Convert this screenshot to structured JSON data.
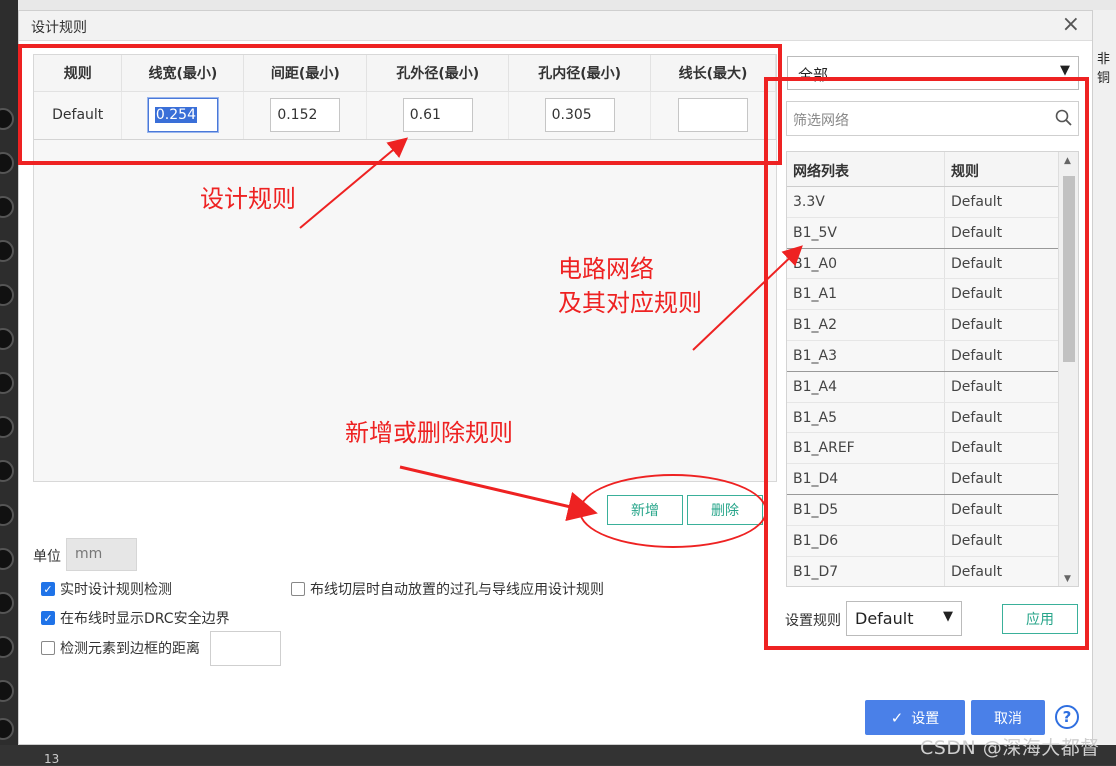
{
  "dialog": {
    "title": "设计规则",
    "close_icon": "×"
  },
  "rules_table": {
    "headers": [
      "规则",
      "线宽(最小)",
      "间距(最小)",
      "孔外径(最小)",
      "孔内径(最小)",
      "线长(最大)"
    ],
    "rows": [
      {
        "name": "Default",
        "line_width": "0.254",
        "spacing": "0.152",
        "hole_outer": "0.61",
        "hole_inner": "0.305",
        "line_length": ""
      }
    ]
  },
  "rule_buttons": {
    "add": "新增",
    "delete": "删除"
  },
  "options": {
    "unit_label": "单位",
    "unit_value": "mm",
    "realtime_drc": {
      "label": "实时设计规则检测",
      "checked": true
    },
    "show_drc_boundary": {
      "label": "在布线时显示DRC安全边界",
      "checked": true
    },
    "check_border_distance": {
      "label": "检测元素到边框的距离",
      "checked": false
    },
    "auto_via_rule": {
      "label": "布线切层时自动放置的过孔与导线应用设计规则",
      "checked": false
    }
  },
  "right_panel": {
    "filter_select": "全部",
    "filter_placeholder": "筛选网络",
    "net_headers": [
      "网络列表",
      "规则"
    ],
    "nets": [
      {
        "net": "3.3V",
        "rule": "Default"
      },
      {
        "net": "B1_5V",
        "rule": "Default"
      },
      {
        "net": "B1_A0",
        "rule": "Default"
      },
      {
        "net": "B1_A1",
        "rule": "Default"
      },
      {
        "net": "B1_A2",
        "rule": "Default"
      },
      {
        "net": "B1_A3",
        "rule": "Default"
      },
      {
        "net": "B1_A4",
        "rule": "Default"
      },
      {
        "net": "B1_A5",
        "rule": "Default"
      },
      {
        "net": "B1_AREF",
        "rule": "Default"
      },
      {
        "net": "B1_D4",
        "rule": "Default"
      },
      {
        "net": "B1_D5",
        "rule": "Default"
      },
      {
        "net": "B1_D6",
        "rule": "Default"
      },
      {
        "net": "B1_D7",
        "rule": "Default"
      }
    ],
    "set_rule_label": "设置规则",
    "set_rule_value": "Default",
    "apply_button": "应用"
  },
  "footer": {
    "ok_button": "设置",
    "cancel_button": "取消",
    "help_icon": "?"
  },
  "annotations": {
    "design_rules": "设计规则",
    "net_rules_line1": "电路网络",
    "net_rules_line2": "及其对应规则",
    "add_delete": "新增或删除规则"
  },
  "background": {
    "right_edge_text": "非铜",
    "bottom_number": "13",
    "watermark": "CSDN @深海大都督"
  },
  "colors": {
    "annotation_red": "#ee2222",
    "primary_blue": "#4a80e8",
    "teal": "#27a58a"
  }
}
